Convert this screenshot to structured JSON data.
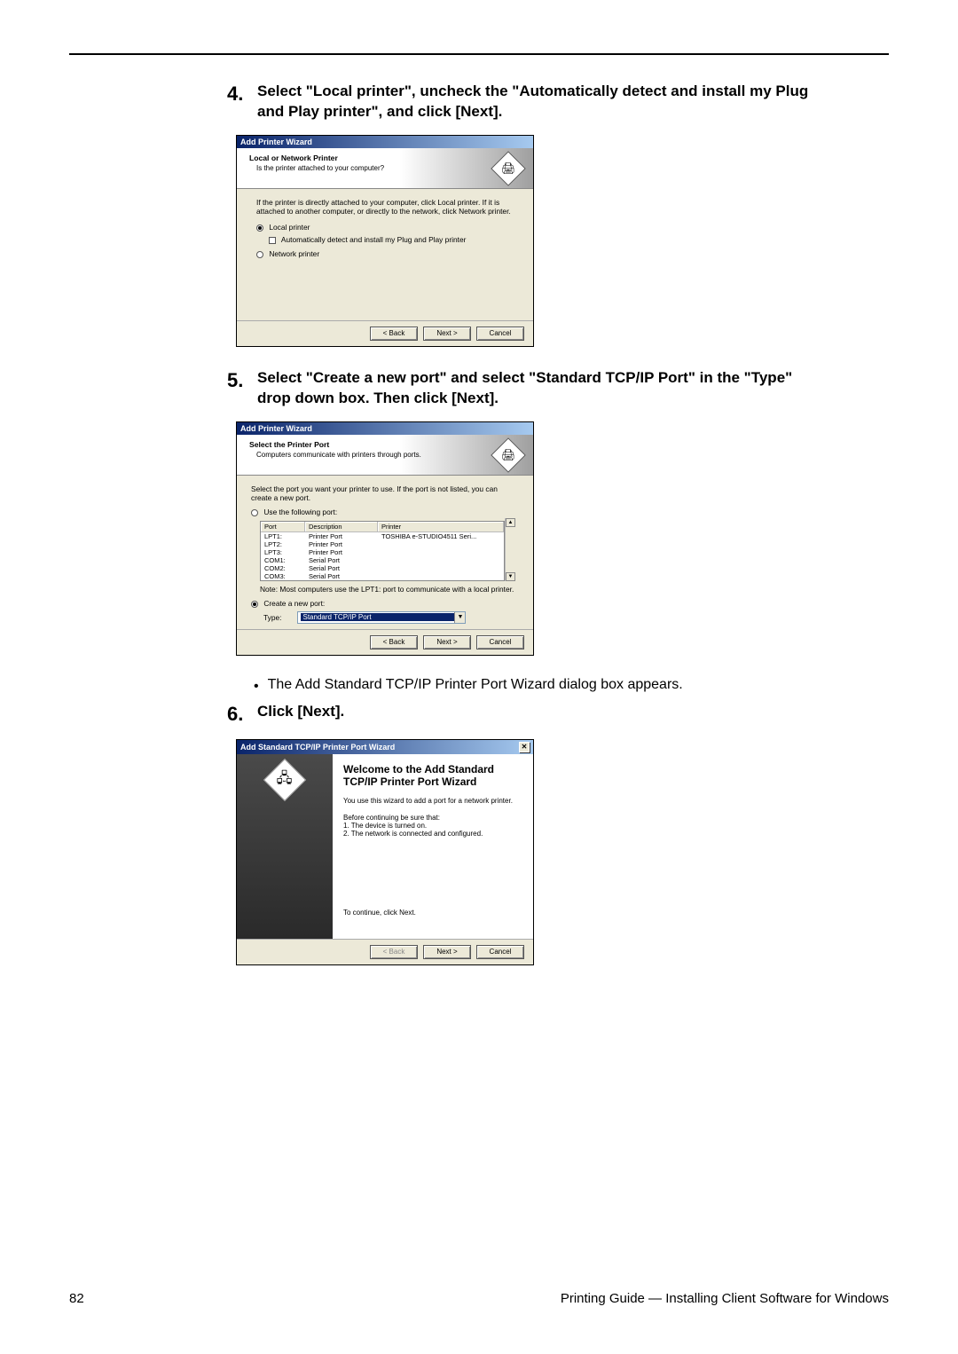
{
  "steps": {
    "s4": {
      "num": "4.",
      "text": "Select \"Local printer\", uncheck the \"Automatically detect and install my Plug and Play printer\", and click [Next]."
    },
    "s5": {
      "num": "5.",
      "text": "Select \"Create a new port\" and select \"Standard TCP/IP Port\" in the \"Type\" drop down box.  Then click [Next]."
    },
    "bullet": "The Add Standard TCP/IP Printer Port Wizard dialog box appears.",
    "s6": {
      "num": "6.",
      "text": "Click [Next]."
    }
  },
  "dlg1": {
    "title": "Add Printer Wizard",
    "header_title": "Local or Network Printer",
    "header_sub": "Is the printer attached to your computer?",
    "info": "If the printer is directly attached to your computer, click Local printer.  If it is attached to another computer, or directly to the network, click Network printer.",
    "opt_local": "Local printer",
    "opt_auto": "Automatically detect and install my Plug and Play printer",
    "opt_net": "Network printer",
    "btn_back": "< Back",
    "btn_next": "Next >",
    "btn_cancel": "Cancel"
  },
  "dlg2": {
    "title": "Add Printer Wizard",
    "header_title": "Select the Printer Port",
    "header_sub": "Computers communicate with printers through ports.",
    "info": "Select the port you want your printer to use.  If the port is not listed, you can create a new port.",
    "opt_use": "Use the following port:",
    "th_port": "Port",
    "th_desc": "Description",
    "th_prn": "Printer",
    "rows": [
      {
        "port": "LPT1:",
        "desc": "Printer Port",
        "prn": "TOSHIBA e-STUDIO4511 Seri..."
      },
      {
        "port": "LPT2:",
        "desc": "Printer Port",
        "prn": ""
      },
      {
        "port": "LPT3:",
        "desc": "Printer Port",
        "prn": ""
      },
      {
        "port": "COM1:",
        "desc": "Serial Port",
        "prn": ""
      },
      {
        "port": "COM2:",
        "desc": "Serial Port",
        "prn": ""
      },
      {
        "port": "COM3:",
        "desc": "Serial Port",
        "prn": ""
      }
    ],
    "note": "Note: Most computers use the LPT1: port to communicate with a local printer.",
    "opt_create": "Create a new port:",
    "type_label": "Type:",
    "type_value": "Standard TCP/IP Port",
    "btn_back": "< Back",
    "btn_next": "Next >",
    "btn_cancel": "Cancel"
  },
  "dlg3": {
    "title": "Add Standard TCP/IP Printer Port Wizard",
    "welcome_title": "Welcome to the Add Standard TCP/IP Printer Port Wizard",
    "line1": "You use this wizard to add a port for a network printer.",
    "line2": "Before continuing be sure that:",
    "line3": "1.  The device is turned on.",
    "line4": "2.  The network is connected and configured.",
    "continue": "To continue, click Next.",
    "btn_back": "< Back",
    "btn_next": "Next >",
    "btn_cancel": "Cancel"
  },
  "footer": {
    "page": "82",
    "text": "Printing Guide — Installing Client Software for Windows"
  }
}
